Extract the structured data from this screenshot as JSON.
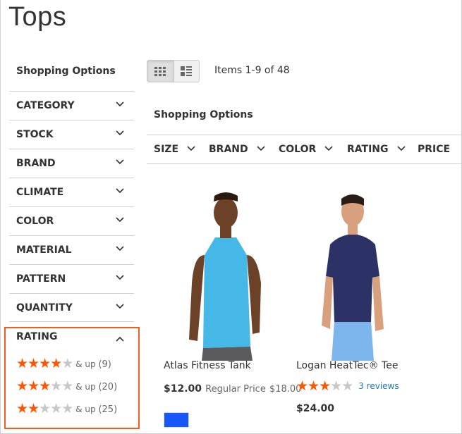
{
  "page": {
    "title": "Tops"
  },
  "sidebar": {
    "title": "Shopping Options",
    "filters": [
      {
        "label": "CATEGORY"
      },
      {
        "label": "STOCK"
      },
      {
        "label": "BRAND"
      },
      {
        "label": "CLIMATE"
      },
      {
        "label": "COLOR"
      },
      {
        "label": "MATERIAL"
      },
      {
        "label": "PATTERN"
      },
      {
        "label": "QUANTITY"
      }
    ],
    "rating": {
      "label": "RATING",
      "highlight_color": "#f05d1e",
      "options": [
        {
          "stars": 4,
          "max": 5,
          "label": "& up",
          "count": "(9)"
        },
        {
          "stars": 3,
          "max": 5,
          "label": "& up",
          "count": "(20)"
        },
        {
          "stars": 2,
          "max": 5,
          "label": "& up",
          "count": "(25)"
        }
      ]
    }
  },
  "toolbar": {
    "modes": [
      {
        "name": "grid",
        "icon": "grid-icon",
        "active": true
      },
      {
        "name": "list",
        "icon": "list-icon",
        "active": false
      }
    ],
    "items_count": "Items 1-9 of 48"
  },
  "top_filters": {
    "title": "Shopping Options",
    "items": [
      {
        "label": "SIZE"
      },
      {
        "label": "BRAND"
      },
      {
        "label": "COLOR"
      },
      {
        "label": "RATING"
      },
      {
        "label": "PRICE"
      }
    ]
  },
  "products": [
    {
      "name": "Atlas Fitness Tank",
      "price": "$12.00",
      "regular_price_label": "Regular Price",
      "regular_price": "$18.00",
      "swatch_color": "#1857f7"
    },
    {
      "name": "Logan HeatTec® Tee",
      "rating": 3,
      "rating_max": 5,
      "reviews": "3 reviews",
      "price": "$24.00"
    }
  ],
  "colors": {
    "star_on": "#ff5501",
    "star_off": "#c7c7c7",
    "link": "#1979c3"
  }
}
